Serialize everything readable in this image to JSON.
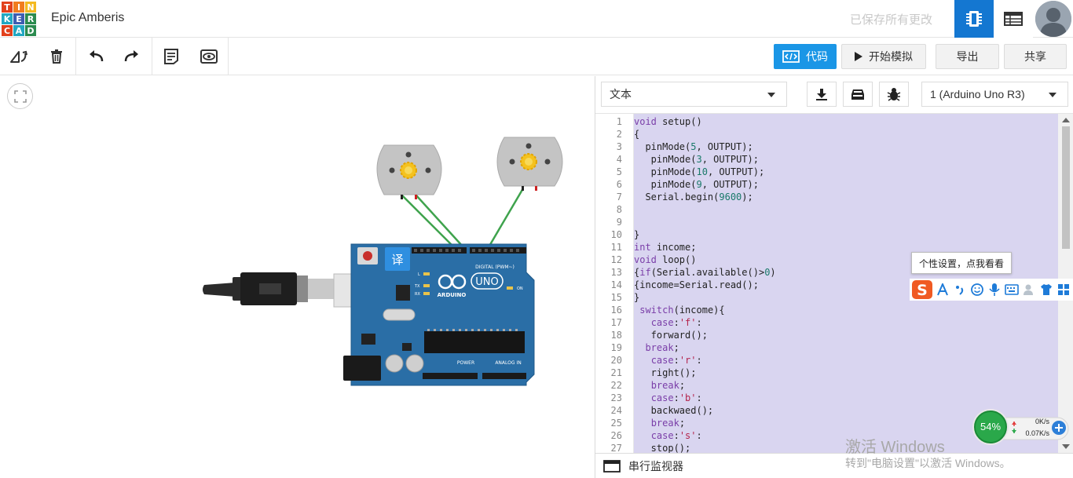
{
  "logo": {
    "letters": [
      "T",
      "I",
      "N",
      "K",
      "E",
      "R",
      "C",
      "A",
      "D"
    ],
    "colors": [
      "#e2411c",
      "#f17c1f",
      "#f4b920",
      "#22a7c2",
      "#3e5db1",
      "#2b8b4f",
      "#e2411c",
      "#22a7c2",
      "#2b8b4f"
    ]
  },
  "header": {
    "project_title": "Epic Amberis",
    "save_status": "已保存所有更改"
  },
  "toolbar": {
    "code_label": "代码",
    "simulate_label": "开始模拟",
    "export_label": "导出",
    "share_label": "共享"
  },
  "editor": {
    "mode_select": "文本",
    "device_select": "1 (Arduino Uno R3)",
    "lines": [
      {
        "n": "1",
        "t": "void setup()"
      },
      {
        "n": "2",
        "t": "{"
      },
      {
        "n": "3",
        "t": "  pinMode(5, OUTPUT);"
      },
      {
        "n": "4",
        "t": "   pinMode(3, OUTPUT);"
      },
      {
        "n": "5",
        "t": "   pinMode(10, OUTPUT);"
      },
      {
        "n": "6",
        "t": "   pinMode(9, OUTPUT);"
      },
      {
        "n": "7",
        "t": "  Serial.begin(9600);"
      },
      {
        "n": "8",
        "t": ""
      },
      {
        "n": "9",
        "t": ""
      },
      {
        "n": "10",
        "t": "}"
      },
      {
        "n": "11",
        "t": "int income;"
      },
      {
        "n": "12",
        "t": "void loop()"
      },
      {
        "n": "13",
        "t": "{if(Serial.available()>0)"
      },
      {
        "n": "14",
        "t": "{income=Serial.read();"
      },
      {
        "n": "15",
        "t": "}"
      },
      {
        "n": "16",
        "t": " switch(income){"
      },
      {
        "n": "17",
        "t": "   case:'f':"
      },
      {
        "n": "18",
        "t": "   forward();"
      },
      {
        "n": "19",
        "t": "  break;"
      },
      {
        "n": "20",
        "t": "   case:'r':"
      },
      {
        "n": "21",
        "t": "   right();"
      },
      {
        "n": "22",
        "t": "   break;"
      },
      {
        "n": "23",
        "t": "   case:'b':"
      },
      {
        "n": "24",
        "t": "   backwaed();"
      },
      {
        "n": "25",
        "t": "   break;"
      },
      {
        "n": "26",
        "t": "   case:'s':"
      },
      {
        "n": "27",
        "t": "   stop();"
      }
    ],
    "serial_monitor_label": "串行监视器"
  },
  "board": {
    "name": "UNO",
    "brand": "ARDUINO",
    "digital_label": "DIGITAL (PWM~)",
    "power_label": "POWER",
    "analog_label": "ANALOG IN",
    "on_label": "ON",
    "l_label": "L",
    "tx_label": "TX",
    "rx_label": "RX",
    "translate_badge": "译"
  },
  "ime": {
    "tooltip": "个性设置，点我看看"
  },
  "netmon": {
    "percent": "54%",
    "up": "0K/s",
    "down": "0.07K/s"
  },
  "watermark": {
    "line1": "激活 Windows",
    "line2": "转到\"电脑设置\"以激活 Windows。"
  },
  "colors": {
    "accent": "#1a96e6",
    "board": "#2a6ea6",
    "wire": "#3fa34d",
    "code_bg": "#d9d5f0"
  }
}
